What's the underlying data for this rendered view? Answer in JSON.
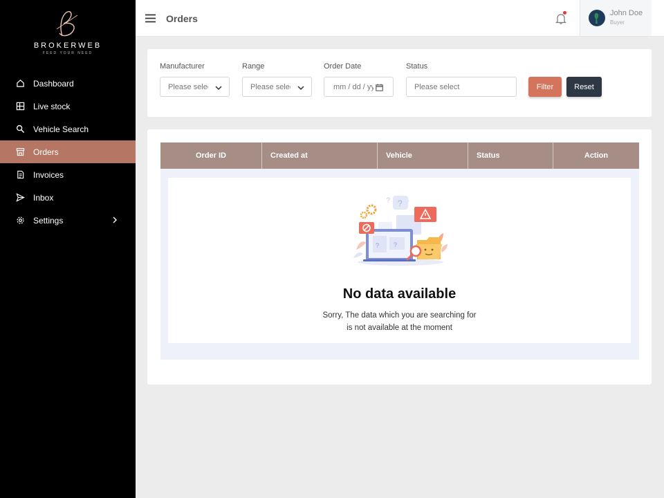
{
  "brand": {
    "name": "BROKERWEB",
    "tagline": "FEED YOUR NEED"
  },
  "sidebar": {
    "items": [
      {
        "label": "Dashboard",
        "icon": "home-icon"
      },
      {
        "label": "Live stock",
        "icon": "grid-icon"
      },
      {
        "label": "Vehicle Search",
        "icon": "search-icon"
      },
      {
        "label": "Orders",
        "icon": "store-icon",
        "active": true
      },
      {
        "label": "Invoices",
        "icon": "invoice-icon"
      },
      {
        "label": "Inbox",
        "icon": "send-icon"
      },
      {
        "label": "Settings",
        "icon": "gear-icon",
        "has_submenu": true
      }
    ]
  },
  "header": {
    "title": "Orders",
    "user": {
      "name": "John Doe",
      "role": "Buyer"
    },
    "notification_dot": true
  },
  "filters": {
    "manufacturer": {
      "label": "Manufacturer",
      "placeholder": "Please select"
    },
    "range": {
      "label": "Range",
      "placeholder": "Please select"
    },
    "order_date": {
      "label": "Order Date",
      "placeholder": "mm / dd / yyyy"
    },
    "status": {
      "label": "Status",
      "placeholder": "Please select"
    },
    "filter_button": "Filter",
    "reset_button": "Reset"
  },
  "table": {
    "columns": [
      "Order ID",
      "Created at",
      "Vehicle",
      "Status",
      "Action"
    ]
  },
  "empty_state": {
    "title": "No data available",
    "message_line1": "Sorry, The data which you are searching for",
    "message_line2": "is not available at the moment"
  },
  "colors": {
    "sidebar_bg": "#000000",
    "active_nav": "#b57764",
    "table_header": "#a68d86",
    "filter_button": "#d4745c",
    "reset_button": "#2e3844"
  }
}
